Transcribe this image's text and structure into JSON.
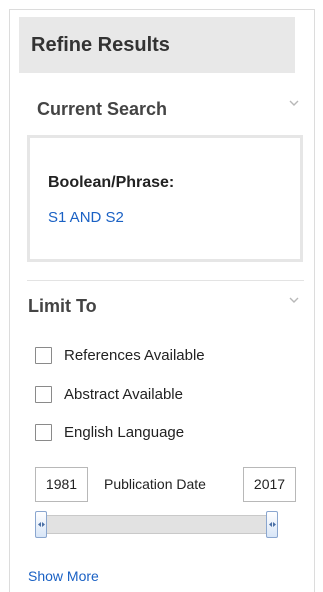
{
  "refine": {
    "title": "Refine Results"
  },
  "current_search": {
    "title": "Current Search",
    "boolean_label": "Boolean/Phrase:",
    "query": "S1 AND S2"
  },
  "limit_to": {
    "title": "Limit To",
    "options": [
      {
        "label": "References Available",
        "checked": false
      },
      {
        "label": "Abstract Available",
        "checked": false
      },
      {
        "label": "English Language",
        "checked": false
      }
    ]
  },
  "publication_date": {
    "label": "Publication Date",
    "from": "1981",
    "to": "2017",
    "range_fraction": [
      0,
      1
    ]
  },
  "show_more": "Show More",
  "icons": {
    "collapse": "chevron-down-icon",
    "slider_grip": "double-arrow-icon"
  },
  "colors": {
    "link": "#1a61c4",
    "header_bg": "#e8e8e8"
  }
}
